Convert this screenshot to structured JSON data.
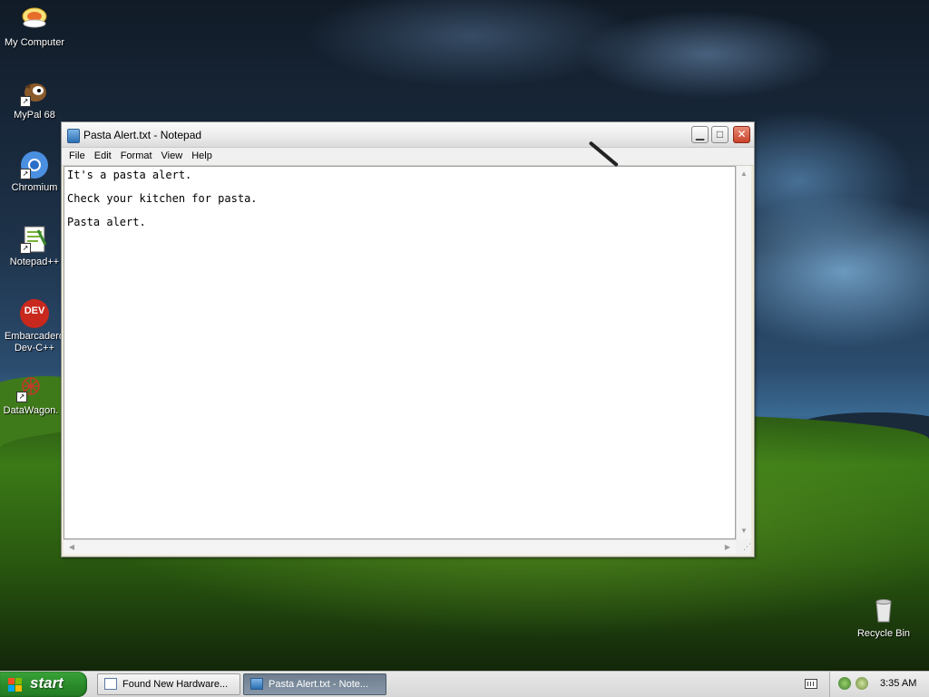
{
  "desktop": {
    "icons": [
      {
        "label": "My Computer",
        "icon": "my-computer-icon"
      },
      {
        "label": "MyPal 68",
        "icon": "mypal-browser-icon"
      },
      {
        "label": "Chromium",
        "icon": "chromium-icon"
      },
      {
        "label": "Notepad++",
        "icon": "notepad-plus-plus-icon"
      },
      {
        "label": "Embarcadero Dev-C++",
        "icon": "dev-cpp-icon",
        "icon_text": "DEV"
      },
      {
        "label": "DataWagon.",
        "icon": "datawagon-icon"
      },
      {
        "label": "Recycle Bin",
        "icon": "recycle-bin-icon"
      }
    ]
  },
  "window": {
    "title": "Pasta Alert.txt - Notepad",
    "menu": [
      "File",
      "Edit",
      "Format",
      "View",
      "Help"
    ],
    "lines": [
      "It's a pasta alert.",
      "Check your kitchen for pasta.",
      "Pasta alert."
    ]
  },
  "taskbar": {
    "start_label": "start",
    "buttons": [
      {
        "label": "Found New Hardware...",
        "active": false
      },
      {
        "label": "Pasta Alert.txt - Note...",
        "active": true
      }
    ],
    "clock": "3:35 AM"
  },
  "colors": {
    "start_green": "#2a8a2a",
    "close_red": "#c9432a",
    "active_task": "#6e7e8e"
  }
}
